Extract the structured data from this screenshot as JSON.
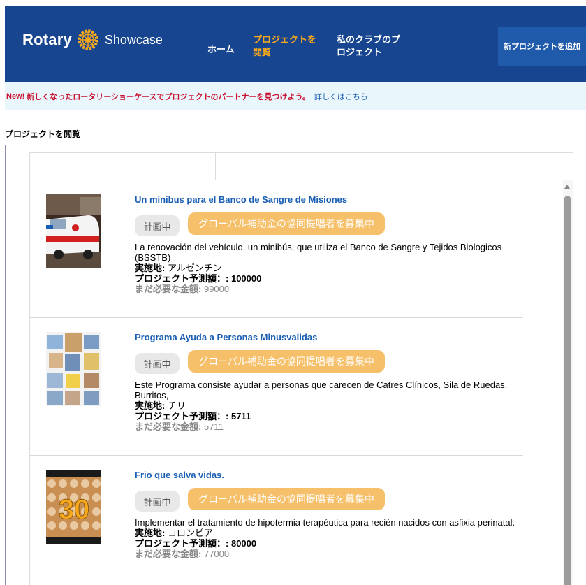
{
  "header": {
    "logo_rotary": "Rotary",
    "logo_showcase": "Showcase",
    "nav": {
      "home": "ホーム",
      "browse": "プロジェクトを閲覧",
      "my_club": "私のクラブのプロジェクト"
    },
    "add_button": "新プロジェクトを追加"
  },
  "announcement": {
    "new_tag": "New!",
    "message": "新しくなったロータリーショーケースでプロジェクトのパートナーを見つけよう。",
    "link": "詳しくはこちら"
  },
  "page_title": "プロジェクトを閲覧",
  "labels": {
    "location": "実施地:",
    "budget": "プロジェクト予測額：:",
    "needed": "まだ必要な金額:"
  },
  "projects": [
    {
      "title": "Un minibus para el Banco de Sangre de Misiones",
      "status": "計画中",
      "grant_badge": "グローバル補助金の協同提唱者を募集中",
      "description": "La renovación del vehículo, un minibús, que utiliza el Banco de Sangre y Tejidos Biologicos (BSSTB)",
      "location": "アルゼンチン",
      "budget": "100000",
      "needed": "99000"
    },
    {
      "title": "Programa Ayuda a Personas Minusvalidas",
      "status": "計画中",
      "grant_badge": "グローバル補助金の協同提唱者を募集中",
      "description": "Este Programa consiste ayudar a personas que carecen de Catres Clínicos, Sila de Ruedas, Burritos,",
      "location": "チリ",
      "budget": "5711",
      "needed": "5711"
    },
    {
      "title": "Frio que salva vidas.",
      "status": "計画中",
      "grant_badge": "グローバル補助金の協同提唱者を募集中",
      "description": "Implementar el tratamiento de hipotermia terapéutica para recién nacidos con asfixia perinatal.",
      "location": "コロンビア",
      "budget": "80000",
      "needed": "77000",
      "thumb_text": "30"
    }
  ],
  "colors": {
    "header_bg": "#17458f",
    "accent_gold": "#f7a81b",
    "grant_badge": "#f6c06a",
    "link_blue": "#1a5fb4",
    "announce_red": "#c8102e"
  }
}
